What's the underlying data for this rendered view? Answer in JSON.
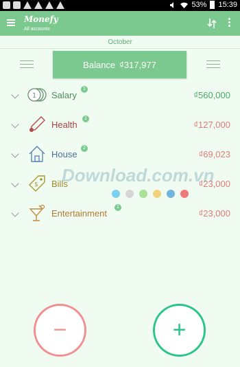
{
  "status_bar": {
    "battery": "53%",
    "time": "15:39"
  },
  "app_bar": {
    "title": "Monefy",
    "subtitle": "All accounts"
  },
  "month": "October",
  "balance": {
    "label": "Balance",
    "value": "₫317,977"
  },
  "categories": [
    {
      "label": "Salary",
      "badge": "1",
      "amount": "₫560,000",
      "icon": "coins-icon",
      "label_color": "#4f8a5e",
      "amount_color": "#4aaa6a"
    },
    {
      "label": "Health",
      "badge": "1",
      "amount": "₫127,000",
      "icon": "thermometer-icon",
      "label_color": "#a34040",
      "amount_color": "#e07b7b"
    },
    {
      "label": "House",
      "badge": "2",
      "amount": "₫69,023",
      "icon": "house-icon",
      "label_color": "#4a6f9c",
      "amount_color": "#e07b7b"
    },
    {
      "label": "Bills",
      "badge": "",
      "amount": "₫23,000",
      "icon": "bill-tag-icon",
      "label_color": "#9a8a2a",
      "amount_color": "#e07b7b"
    },
    {
      "label": "Entertainment",
      "badge": "1",
      "amount": "₫23,000",
      "icon": "cocktail-icon",
      "label_color": "#b07a32",
      "amount_color": "#e07b7b"
    }
  ],
  "watermark": "Download.com.vn",
  "dot_colors": [
    "#7ed0ef",
    "#d6d6d6",
    "#a8e096",
    "#f2d37c",
    "#6fb5dd",
    "#ee7b7b"
  ],
  "fab": {
    "minus": "−",
    "plus": "+"
  }
}
